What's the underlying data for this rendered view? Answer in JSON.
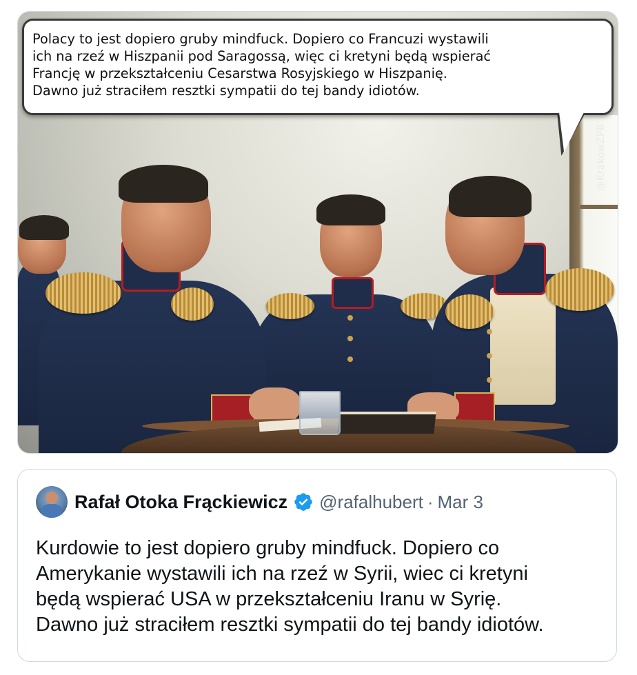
{
  "image": {
    "bubble_text": "Polacy to jest dopiero gruby mindfuck. Dopiero co Francuzi wystawili\nich na rzeź w Hiszpanii pod Saragossą, więc ci kretyni będą wspierać\nFrancję w przekształceniu Cesarstwa Rosyjskiego w Hiszpanię.\nDawno już straciłem resztki sympatii do tej bandy idiotów.",
    "watermark": "@KrakowZPB"
  },
  "quoted_tweet": {
    "author_name": "Rafał Otoka Frąckiewicz",
    "verified_icon": "verified-badge-icon",
    "handle": "@rafalhubert",
    "separator": "·",
    "date": "Mar 3",
    "text": "Kurdowie to jest dopiero gruby mindfuck. Dopiero co\nAmerykanie wystawili ich na rzeź w Syrii, wiec ci kretyni\nbędą wspierać USA w przekształceniu Iranu w Syrię.\nDawno już straciłem resztki sympatii do tej bandy idiotów."
  },
  "colors": {
    "verified_blue": "#1d9bf0",
    "secondary_text": "#536471",
    "border": "#cfd9de"
  }
}
